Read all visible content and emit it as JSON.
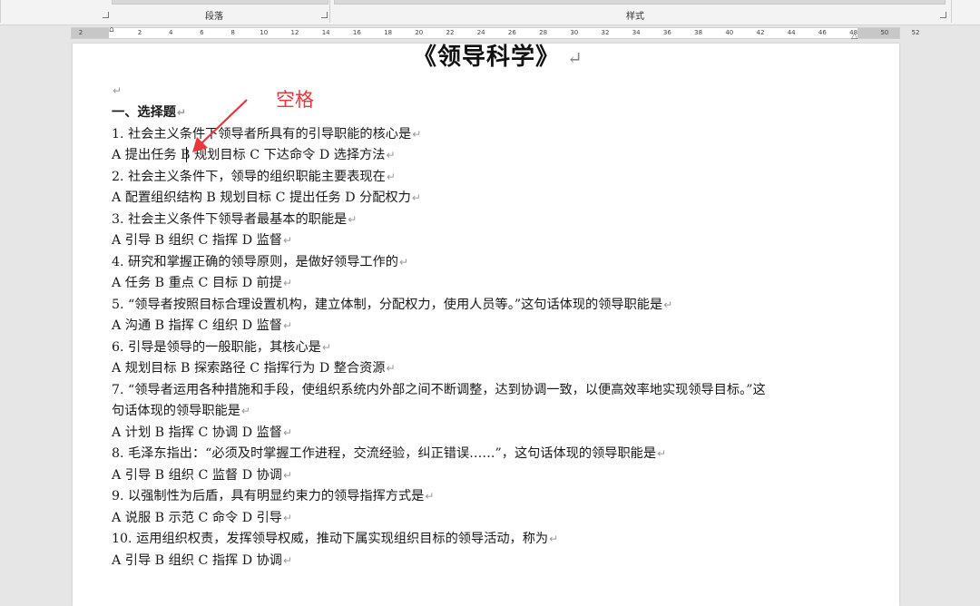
{
  "ribbon": {
    "paragraph_group": "段落",
    "styles_group": "样式"
  },
  "ruler": {
    "labels": [
      "2",
      "2",
      "4",
      "6",
      "8",
      "10",
      "12",
      "14",
      "16",
      "18",
      "20",
      "22",
      "24",
      "26",
      "28",
      "30",
      "32",
      "34",
      "36",
      "38",
      "40",
      "42",
      "44",
      "46",
      "48",
      "50",
      "52"
    ]
  },
  "document": {
    "title": "《领导科学》",
    "empty_line": "",
    "lines": [
      {
        "text": "一、选择题",
        "heading": true
      },
      {
        "text": "1. 社会主义条件下领导者所具有的引导职能的核心是"
      },
      {
        "text": "A 提出任务 B 规划目标 C 下达命令 D 选择方法"
      },
      {
        "text": "2. 社会主义条件下，领导的组织职能主要表现在"
      },
      {
        "text": "A 配置组织结构 B 规划目标 C 提出任务 D 分配权力"
      },
      {
        "text": "3. 社会主义条件下领导者最基本的职能是"
      },
      {
        "text": "A 引导 B 组织 C 指挥 D 监督"
      },
      {
        "text": "4. 研究和掌握正确的领导原则，是做好领导工作的"
      },
      {
        "text": "A 任务 B 重点 C 目标 D 前提"
      },
      {
        "text": "5. “领导者按照目标合理设置机构，建立体制，分配权力，使用人员等。”这句话体现的领导职能是"
      },
      {
        "text": "A 沟通 B 指挥 C 组织 D 监督"
      },
      {
        "text": "6. 引导是领导的一般职能，其核心是"
      },
      {
        "text": "A 规划目标 B 探索路径 C 指挥行为 D 整合资源"
      },
      {
        "text": "7. “领导者运用各种措施和手段，使组织系统内外部之间不断调整，达到协调一致，以便高效率地实现领导目标。”这",
        "no_mark": true
      },
      {
        "text": "句话体现的领导职能是"
      },
      {
        "text": "A 计划 B 指挥 C 协调 D 监督"
      },
      {
        "text": "8. 毛泽东指出：“必须及时掌握工作进程，交流经验，纠正错误……”，这句话体现的领导职能是"
      },
      {
        "text": "A 引导 B 组织 C 监督 D 协调"
      },
      {
        "text": "9. 以强制性为后盾，具有明显约束力的领导指挥方式是"
      },
      {
        "text": "A 说服 B 示范 C 命令 D 引导"
      },
      {
        "text": "10. 运用组织权责，发挥领导权威，推动下属实现组织目标的领导活动，称为"
      },
      {
        "text": "A 引导 B 组织 C 指挥 D 协调"
      }
    ]
  },
  "annotation": {
    "label": "空格",
    "color": "#e8383d"
  },
  "paragraph_mark": "↵"
}
